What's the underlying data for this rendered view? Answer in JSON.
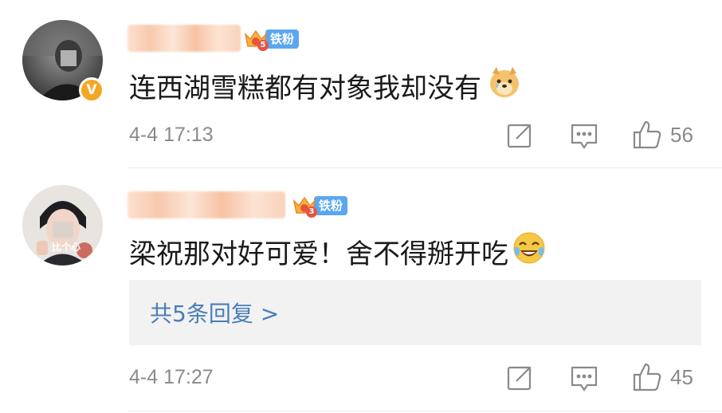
{
  "comments": [
    {
      "fan_level": "5",
      "fan_label": "铁粉",
      "text": "连西湖雪糕都有对象我却没有",
      "time": "4-4 17:13",
      "like_count": "56",
      "emoji": "doge-dog-emoji",
      "avatar_caption": ""
    },
    {
      "fan_level": "3",
      "fan_label": "铁粉",
      "text": "梁祝那对好可爱！舍不得掰开吃",
      "time": "4-4 17:27",
      "like_count": "45",
      "emoji": "laughing-crying-emoji",
      "avatar_caption": "比个心",
      "reply_link": "共5条回复 >"
    }
  ],
  "colors": {
    "badge_bg": "#5aa7f0",
    "verified_badge": "#f5a623",
    "reply_link": "#4a7db8",
    "reply_box_bg": "#f2f2f2",
    "meta_gray": "#8a8a8a"
  },
  "icons": [
    "share-icon",
    "comment-icon",
    "like-icon"
  ]
}
